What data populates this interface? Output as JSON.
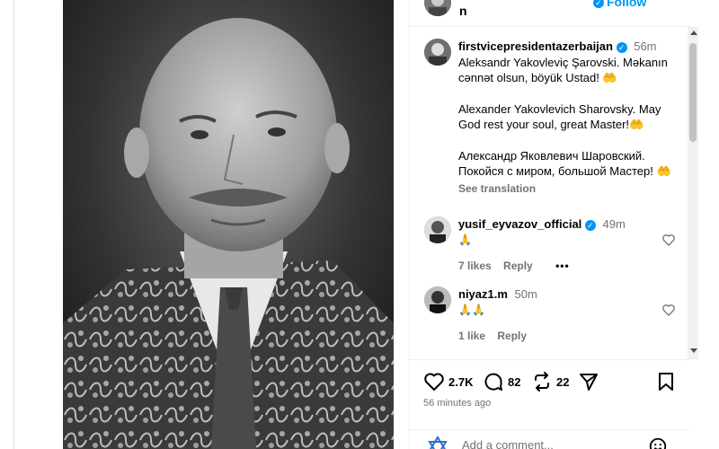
{
  "header": {
    "username_trail": "n",
    "follow_label": "Follow",
    "more_label": "•••"
  },
  "caption": {
    "username": "firstvicepresidentazerbaijan",
    "time": "56m",
    "line_az": "Aleksandr Yakovleviç Şarovski. Məkanın cənnət olsun, böyük Ustad! 🤲",
    "line_en": "Alexander Yakovlevich Sharovsky. May God rest your soul, great Master!🤲",
    "line_ru": "Александр Яковлевич Шаровский. Покойся с миром, большой Мастер! 🤲",
    "see_translation": "See translation"
  },
  "comments": [
    {
      "username": "yusif_eyvazov_official",
      "verified": true,
      "time": "49m",
      "text": "🙏",
      "likes": "7 likes",
      "reply": "Reply",
      "more": "•••"
    },
    {
      "username": "niyaz1.m",
      "verified": false,
      "time": "50m",
      "text": "🙏🙏",
      "likes": "1 like",
      "reply": "Reply"
    }
  ],
  "actions": {
    "like_count": "2.7K",
    "comment_count": "82",
    "repost_count": "22",
    "time_ago": "56 minutes ago"
  },
  "add_comment": {
    "placeholder": "Add a comment..."
  }
}
